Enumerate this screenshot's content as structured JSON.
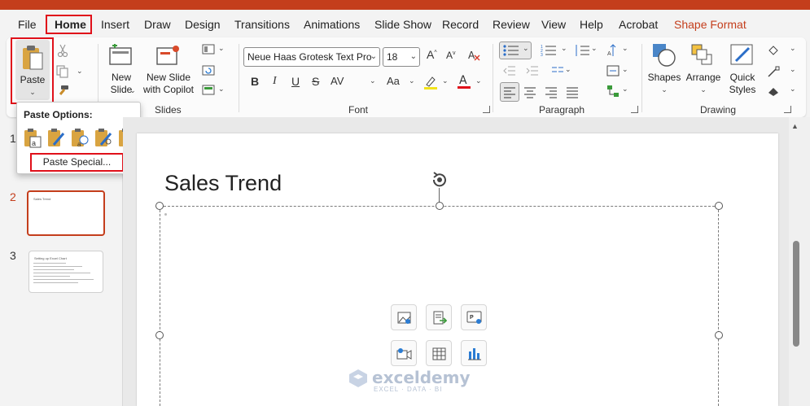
{
  "menu": {
    "tabs": [
      "File",
      "Home",
      "Insert",
      "Draw",
      "Design",
      "Transitions",
      "Animations",
      "Slide Show",
      "Record",
      "Review",
      "View",
      "Help",
      "Acrobat",
      "Shape Format"
    ],
    "active": "Home"
  },
  "ribbon": {
    "clipboard": {
      "paste_label": "Paste"
    },
    "slides": {
      "new_slide": "New Slide",
      "new_slide_l1": "New",
      "new_slide_l2": "Slide",
      "copilot_l1": "New Slide",
      "copilot_l2": "with Copilot",
      "group_label": "Slides"
    },
    "font": {
      "font_name": "Neue Haas Grotesk Text Pro",
      "font_size": "18",
      "group_label": "Font",
      "bold": "B",
      "italic": "I",
      "underline": "U",
      "strike": "S",
      "spacing": "AV",
      "case": "Aa"
    },
    "paragraph": {
      "group_label": "Paragraph"
    },
    "drawing": {
      "shapes": "Shapes",
      "arrange": "Arrange",
      "quick_l1": "Quick",
      "quick_l2": "Styles",
      "group_label": "Drawing"
    }
  },
  "paste_menu": {
    "title": "Paste Options:",
    "special": "Paste Special..."
  },
  "thumbnails": [
    {
      "num": "1"
    },
    {
      "num": "2",
      "title": "Sales Trend",
      "active": true
    },
    {
      "num": "3",
      "title": "Setting up Excel Chart"
    }
  ],
  "slide": {
    "title": "Sales Trend"
  },
  "watermark": {
    "brand": "exceldemy",
    "sub": "EXCEL · DATA · BI"
  },
  "colors": {
    "accent": "#c43e1c",
    "highlight": "#e0101a"
  }
}
